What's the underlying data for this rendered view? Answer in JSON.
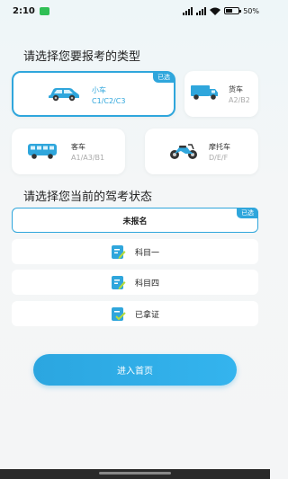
{
  "status_bar": {
    "time": "2:10",
    "battery": "50%"
  },
  "vehicle_section": {
    "title": "请选择您要报考的类型",
    "cards": [
      {
        "name": "小车",
        "codes": "C1/C2/C3",
        "selected": true,
        "badge": "已选",
        "icon": "car-icon",
        "color": "#2fa6dc"
      },
      {
        "name": "货车",
        "codes": "A2/B2",
        "selected": false,
        "icon": "truck-icon",
        "color": "#2fa6dc"
      },
      {
        "name": "客车",
        "codes": "A1/A3/B1",
        "selected": false,
        "icon": "bus-icon",
        "color": "#2fa6dc"
      },
      {
        "name": "摩托车",
        "codes": "D/E/F",
        "selected": false,
        "icon": "motorcycle-icon",
        "color": "#2fa6dc"
      }
    ]
  },
  "status_section": {
    "title": "请选择您当前的驾考状态",
    "options": [
      {
        "label": "未报名",
        "selected": true,
        "badge": "已选"
      },
      {
        "label": "科目一",
        "selected": false,
        "icon": "document-pencil-icon"
      },
      {
        "label": "科目四",
        "selected": false,
        "icon": "document-pencil-icon"
      },
      {
        "label": "已拿证",
        "selected": false,
        "icon": "document-check-icon"
      }
    ]
  },
  "enter_button": {
    "label": "进入首页"
  },
  "colors": {
    "accent": "#2fa6dc",
    "icon_green": "#b8dc3a"
  }
}
